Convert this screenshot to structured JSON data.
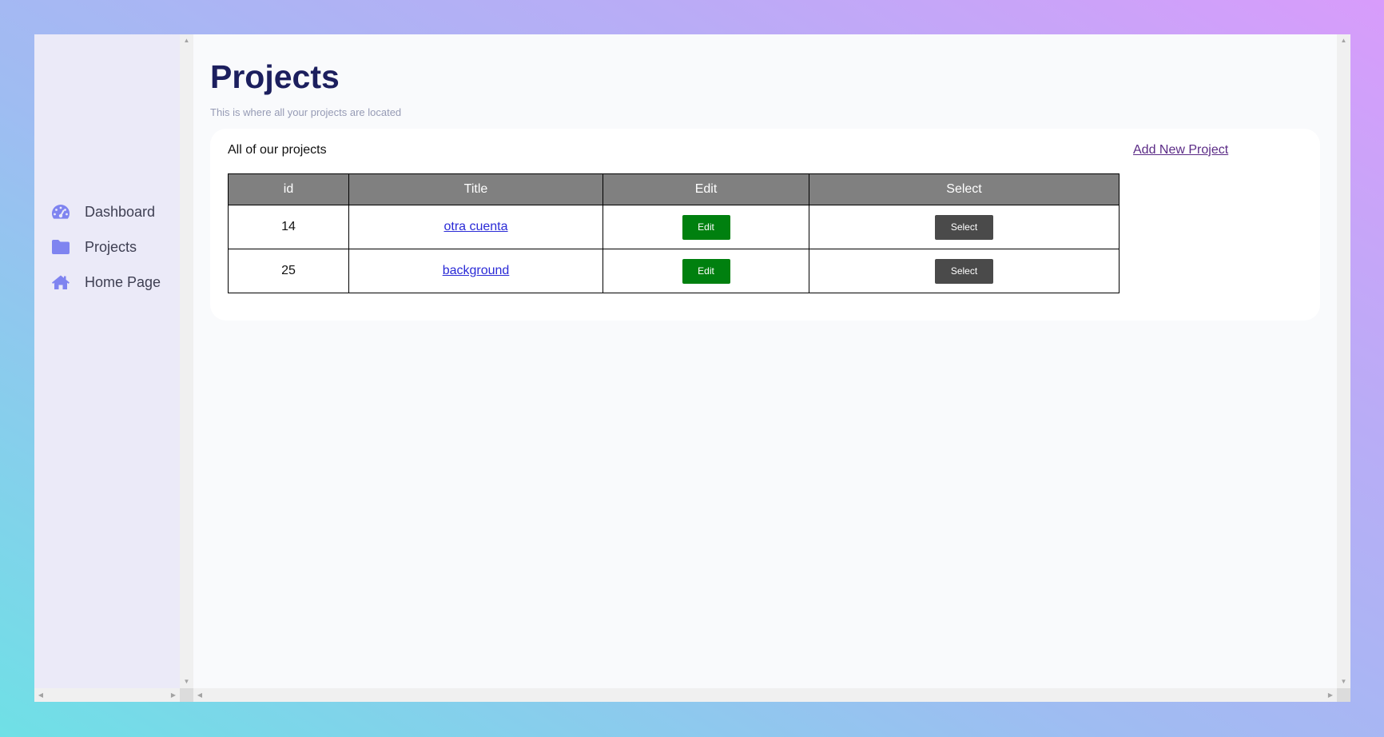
{
  "sidebar": {
    "items": [
      {
        "label": "Dashboard",
        "icon": "dashboard-gauge-icon"
      },
      {
        "label": "Projects",
        "icon": "folder-icon"
      },
      {
        "label": "Home Page",
        "icon": "home-icon"
      }
    ]
  },
  "header": {
    "title": "Projects",
    "subtitle": "This is where all your projects are located"
  },
  "card": {
    "title": "All of our projects",
    "add_link": "Add New Project"
  },
  "table": {
    "columns": [
      "id",
      "Title",
      "Edit",
      "Select"
    ],
    "rows": [
      {
        "id": "14",
        "title": "otra cuenta",
        "edit": "Edit",
        "select": "Select"
      },
      {
        "id": "25",
        "title": "background",
        "edit": "Edit",
        "select": "Select"
      }
    ]
  },
  "colors": {
    "accent": "#7f84f0",
    "title": "#1c1f5e",
    "edit_button": "#00800f",
    "select_button": "#4a4a4a",
    "table_header": "#808080"
  }
}
